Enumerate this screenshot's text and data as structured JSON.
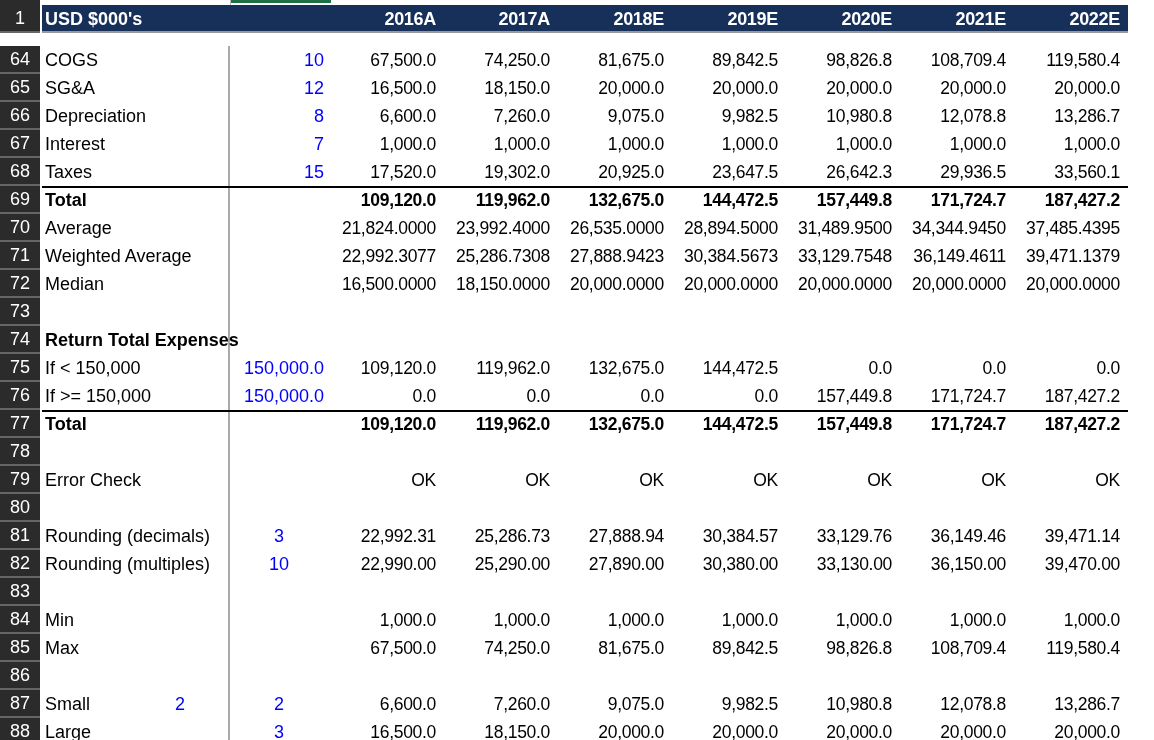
{
  "header": {
    "row_number": "1",
    "label": "USD $000's",
    "years": [
      "2016A",
      "2017A",
      "2018E",
      "2019E",
      "2020E",
      "2021E",
      "2022E"
    ]
  },
  "rows": [
    {
      "row_number": "64",
      "kind": "data",
      "label": "COGS",
      "input": "10",
      "values": [
        "67,500.0",
        "74,250.0",
        "81,675.0",
        "89,842.5",
        "98,826.8",
        "108,709.4",
        "119,580.4"
      ]
    },
    {
      "row_number": "65",
      "kind": "data",
      "label": "SG&A",
      "input": "12",
      "values": [
        "16,500.0",
        "18,150.0",
        "20,000.0",
        "20,000.0",
        "20,000.0",
        "20,000.0",
        "20,000.0"
      ]
    },
    {
      "row_number": "66",
      "kind": "data",
      "label": "Depreciation",
      "input": "8",
      "values": [
        "6,600.0",
        "7,260.0",
        "9,075.0",
        "9,982.5",
        "10,980.8",
        "12,078.8",
        "13,286.7"
      ]
    },
    {
      "row_number": "67",
      "kind": "data",
      "label": "Interest",
      "input": "7",
      "values": [
        "1,000.0",
        "1,000.0",
        "1,000.0",
        "1,000.0",
        "1,000.0",
        "1,000.0",
        "1,000.0"
      ]
    },
    {
      "row_number": "68",
      "kind": "data",
      "label": "Taxes",
      "input": "15",
      "values": [
        "17,520.0",
        "19,302.0",
        "20,925.0",
        "23,647.5",
        "26,642.3",
        "29,936.5",
        "33,560.1"
      ]
    },
    {
      "row_number": "69",
      "kind": "total",
      "label": "Total",
      "values": [
        "109,120.0",
        "119,962.0",
        "132,675.0",
        "144,472.5",
        "157,449.8",
        "171,724.7",
        "187,427.2"
      ]
    },
    {
      "row_number": "70",
      "kind": "data",
      "label": "Average",
      "values": [
        "21,824.0000",
        "23,992.4000",
        "26,535.0000",
        "28,894.5000",
        "31,489.9500",
        "34,344.9450",
        "37,485.4395"
      ]
    },
    {
      "row_number": "71",
      "kind": "data",
      "label": "Weighted Average",
      "values": [
        "22,992.3077",
        "25,286.7308",
        "27,888.9423",
        "30,384.5673",
        "33,129.7548",
        "36,149.4611",
        "39,471.1379"
      ]
    },
    {
      "row_number": "72",
      "kind": "data",
      "label": "Median",
      "values": [
        "16,500.0000",
        "18,150.0000",
        "20,000.0000",
        "20,000.0000",
        "20,000.0000",
        "20,000.0000",
        "20,000.0000"
      ]
    },
    {
      "row_number": "73",
      "kind": "blank"
    },
    {
      "row_number": "74",
      "kind": "section",
      "label": "Return Total Expenses"
    },
    {
      "row_number": "75",
      "kind": "data",
      "label": "If < 150,000",
      "input": "150,000.0",
      "values": [
        "109,120.0",
        "119,962.0",
        "132,675.0",
        "144,472.5",
        "0.0",
        "0.0",
        "0.0"
      ]
    },
    {
      "row_number": "76",
      "kind": "data",
      "label": "If >= 150,000",
      "input": "150,000.0",
      "values": [
        "0.0",
        "0.0",
        "0.0",
        "0.0",
        "157,449.8",
        "171,724.7",
        "187,427.2"
      ]
    },
    {
      "row_number": "77",
      "kind": "total",
      "label": "Total",
      "values": [
        "109,120.0",
        "119,962.0",
        "132,675.0",
        "144,472.5",
        "157,449.8",
        "171,724.7",
        "187,427.2"
      ]
    },
    {
      "row_number": "78",
      "kind": "blank"
    },
    {
      "row_number": "79",
      "kind": "data",
      "label": "Error Check",
      "values": [
        "OK",
        "OK",
        "OK",
        "OK",
        "OK",
        "OK",
        "OK"
      ]
    },
    {
      "row_number": "80",
      "kind": "blank"
    },
    {
      "row_number": "81",
      "kind": "data",
      "label": "Rounding (decimals)",
      "input": "3",
      "input_centered": true,
      "values": [
        "22,992.31",
        "25,286.73",
        "27,888.94",
        "30,384.57",
        "33,129.76",
        "36,149.46",
        "39,471.14"
      ]
    },
    {
      "row_number": "82",
      "kind": "data",
      "label": "Rounding (multiples)",
      "input": "10",
      "input_centered": true,
      "values": [
        "22,990.00",
        "25,290.00",
        "27,890.00",
        "30,380.00",
        "33,130.00",
        "36,150.00",
        "39,470.00"
      ]
    },
    {
      "row_number": "83",
      "kind": "blank"
    },
    {
      "row_number": "84",
      "kind": "data",
      "label": "Min",
      "values": [
        "1,000.0",
        "1,000.0",
        "1,000.0",
        "1,000.0",
        "1,000.0",
        "1,000.0",
        "1,000.0"
      ]
    },
    {
      "row_number": "85",
      "kind": "data",
      "label": "Max",
      "values": [
        "67,500.0",
        "74,250.0",
        "81,675.0",
        "89,842.5",
        "98,826.8",
        "108,709.4",
        "119,580.4"
      ]
    },
    {
      "row_number": "86",
      "kind": "blank"
    },
    {
      "row_number": "87",
      "kind": "data",
      "label": "Small",
      "side_input": "2",
      "input": "2",
      "input_centered": true,
      "values": [
        "6,600.0",
        "7,260.0",
        "9,075.0",
        "9,982.5",
        "10,980.8",
        "12,078.8",
        "13,286.7"
      ]
    },
    {
      "row_number": "88",
      "kind": "data",
      "label": "Large",
      "input": "3",
      "input_centered": true,
      "values": [
        "16,500.0",
        "18,150.0",
        "20,000.0",
        "20,000.0",
        "20,000.0",
        "20,000.0",
        "20,000.0"
      ]
    }
  ]
}
